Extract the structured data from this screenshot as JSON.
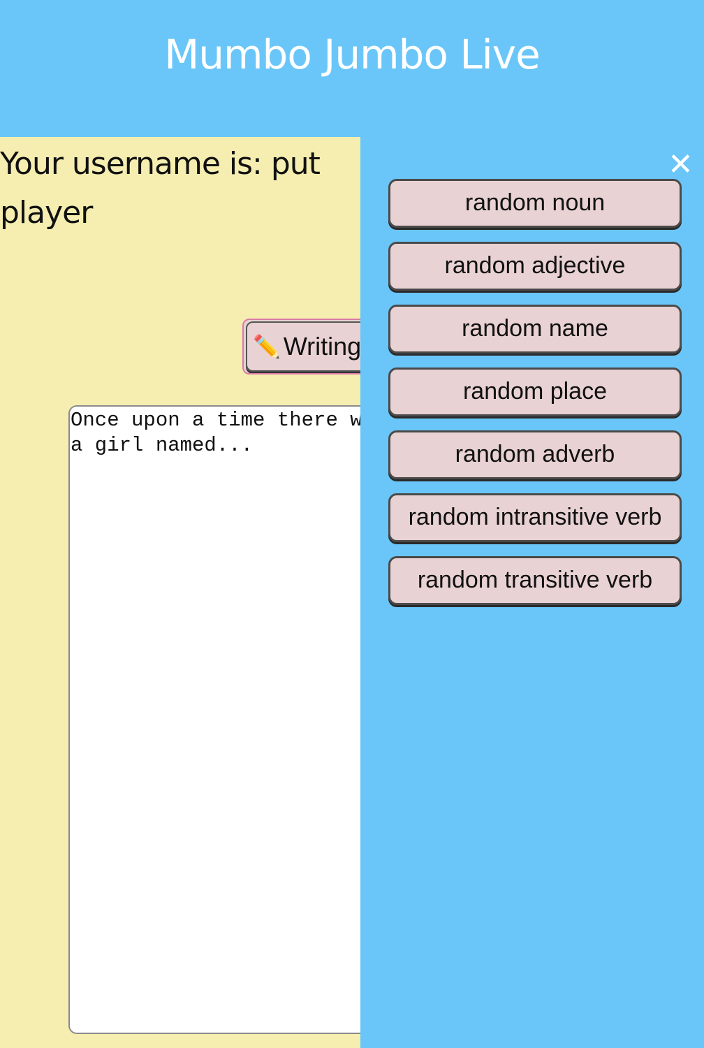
{
  "app": {
    "title": "Mumbo Jumbo Live"
  },
  "player": {
    "username_text": "Your username is: put player"
  },
  "mode_button": {
    "icon": "pencil-icon",
    "icon_glyph": "✏️",
    "label": "Writing"
  },
  "story": {
    "text": "Once upon a time there was a girl named..."
  },
  "sidebar": {
    "close_glyph": "✕",
    "word_buttons": [
      {
        "label": "random noun"
      },
      {
        "label": "random adjective"
      },
      {
        "label": "random name"
      },
      {
        "label": "random place"
      },
      {
        "label": "random adverb"
      },
      {
        "label": "random intransitive verb"
      },
      {
        "label": "random transitive verb"
      }
    ]
  },
  "colors": {
    "header_bg": "#6ac6f8",
    "main_bg": "#f5eeb0",
    "button_bg": "#e9d2d3",
    "mode_button_border": "#d97aa8"
  }
}
